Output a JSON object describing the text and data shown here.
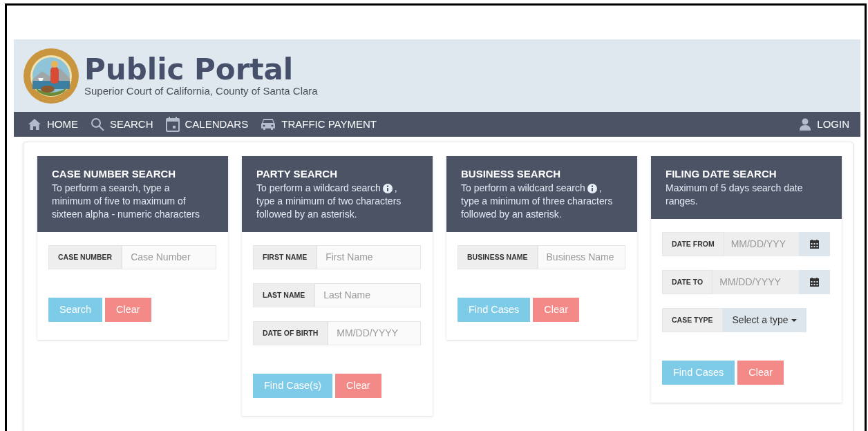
{
  "header": {
    "title": "Public Portal",
    "subtitle": "Superior Court of California, County of Santa Clara"
  },
  "nav": {
    "items": [
      {
        "label": "HOME"
      },
      {
        "label": "SEARCH"
      },
      {
        "label": "CALENDARS"
      },
      {
        "label": "TRAFFIC PAYMENT"
      }
    ],
    "login": "LOGIN"
  },
  "cards": [
    {
      "title": "CASE NUMBER SEARCH",
      "description": "To perform a search, type a minimum of five to maximum of sixteen alpha - numeric characters",
      "fields": [
        {
          "kind": "text",
          "label": "CASE NUMBER",
          "placeholder": "Case Number"
        }
      ],
      "buttons": [
        {
          "kind": "primary",
          "label": "Search"
        },
        {
          "kind": "danger",
          "label": "Clear"
        }
      ]
    },
    {
      "title": "PARTY SEARCH",
      "description": "To perform a wildcard search",
      "description_after_icon": ",",
      "description_rest": "type a minimum of two characters followed by an asterisk.",
      "fields": [
        {
          "kind": "text",
          "label": "FIRST NAME",
          "placeholder": "First Name"
        },
        {
          "kind": "text",
          "label": "LAST NAME",
          "placeholder": "Last Name"
        },
        {
          "kind": "text",
          "label": "DATE OF BIRTH",
          "placeholder": "MM/DD/YYYY"
        }
      ],
      "buttons": [
        {
          "kind": "primary",
          "label": "Find Case(s)"
        },
        {
          "kind": "danger",
          "label": "Clear"
        }
      ]
    },
    {
      "title": "BUSINESS SEARCH",
      "description": "To perform a wildcard search",
      "description_after_icon": ",",
      "description_rest": "type a minimum of three characters followed by an asterisk.",
      "fields": [
        {
          "kind": "text",
          "label": "BUSINESS NAME",
          "placeholder": "Business Name"
        }
      ],
      "buttons": [
        {
          "kind": "primary",
          "label": "Find Cases"
        },
        {
          "kind": "danger",
          "label": "Clear"
        }
      ]
    },
    {
      "title": "FILING DATE SEARCH",
      "description": "Maximum of 5 days search date ranges.",
      "fields": [
        {
          "kind": "date",
          "label": "DATE FROM",
          "placeholder": "MM/DD/YYY"
        },
        {
          "kind": "date",
          "label": "DATE TO",
          "placeholder": "MM/DD/YYYY"
        },
        {
          "kind": "select",
          "label": "CASE TYPE",
          "value": "Select a type"
        }
      ],
      "buttons": [
        {
          "kind": "primary",
          "label": "Find Cases"
        },
        {
          "kind": "danger",
          "label": "Clear"
        }
      ]
    }
  ]
}
